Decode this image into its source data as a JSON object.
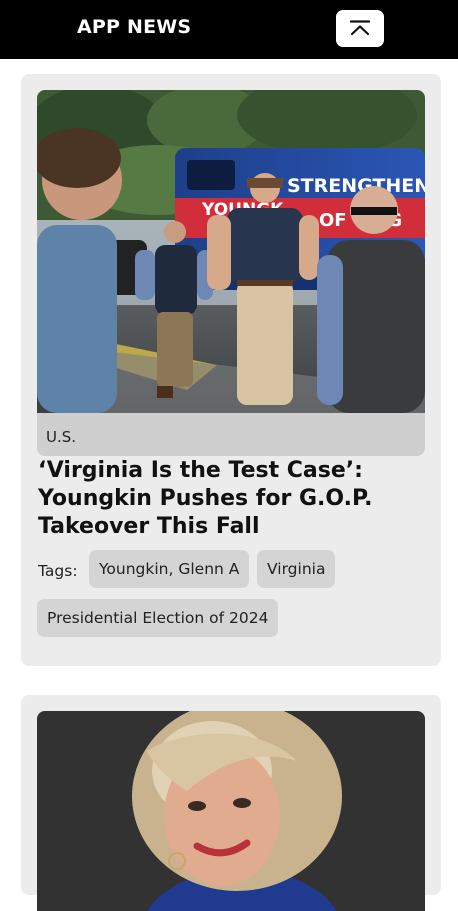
{
  "header": {
    "title": "APP NEWS",
    "scroll_top_icon": "arrow-up-to-line-icon",
    "background": "#000000"
  },
  "articles": [
    {
      "section": "U.S.",
      "headline": "‘Virginia Is the Test Case’: Youngkin Pushes for G.O.P. Takeover This Fall",
      "tags_label": "Tags:",
      "tags": [
        "Youngkin, Glenn A",
        "Virginia",
        "Presidential Election of 2024"
      ],
      "image": {
        "bus_text_1": "STRENGTHENING",
        "bus_text_2": "YOUNGK",
        "bus_text_3": "OF VIRG"
      }
    },
    {
      "image": "portrait-photo"
    }
  ]
}
